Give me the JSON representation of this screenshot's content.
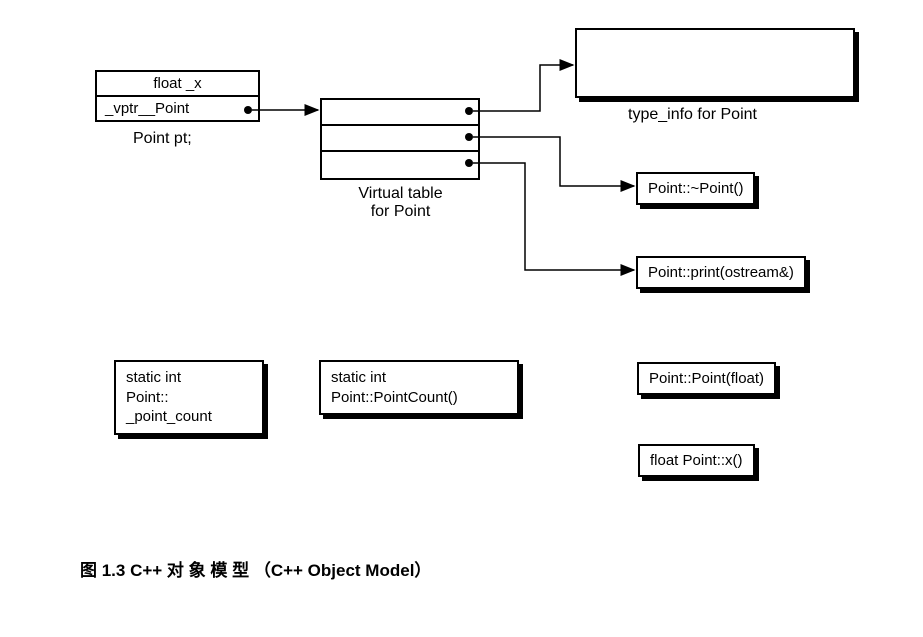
{
  "point_object": {
    "row1": "float _x",
    "row2": "_vptr__Point",
    "label": "Point pt;"
  },
  "vtable": {
    "label_line1": "Virtual table",
    "label_line2": "for Point"
  },
  "typeinfo": {
    "label": "type_info for Point"
  },
  "functions": {
    "dtor": "Point::~Point()",
    "print": "Point::print(ostream&)",
    "ctor": "Point::Point(float)",
    "x": "float Point::x()"
  },
  "statics": {
    "count_line1": "static int",
    "count_line2": "Point::",
    "count_line3": "_point_count",
    "pointcount_line1": "static int",
    "pointcount_line2": "Point::PointCount()"
  },
  "caption": "图 1.3   C++  对 象 模 型  （C++ Object Model）"
}
